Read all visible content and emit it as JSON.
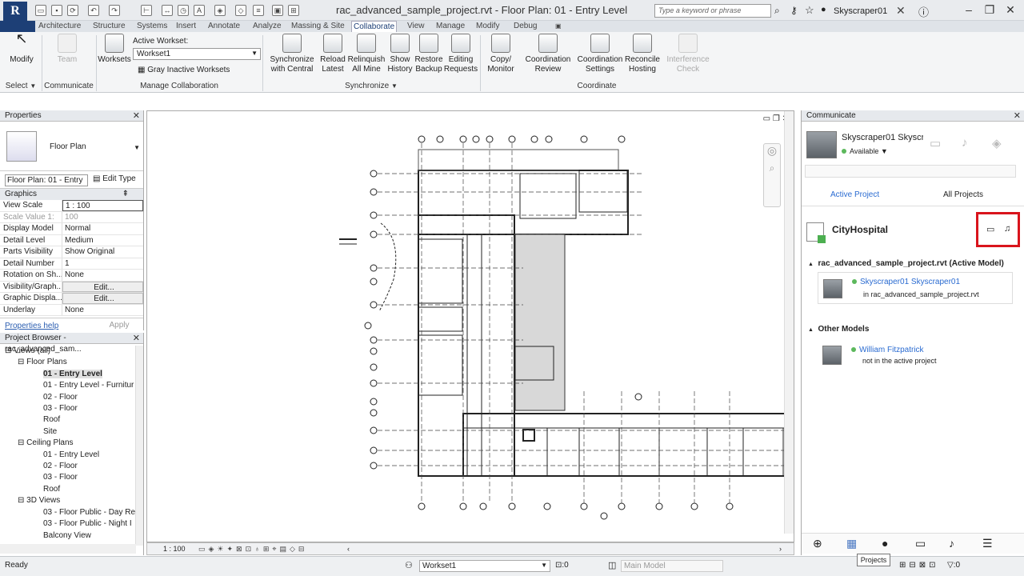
{
  "titlebar": {
    "title": "rac_advanced_sample_project.rvt - Floor Plan: 01 - Entry Level",
    "search_placeholder": "Type a keyword or phrase",
    "username": "Skyscraper01",
    "logo": "R"
  },
  "tabs": [
    "Architecture",
    "Structure",
    "Systems",
    "Insert",
    "Annotate",
    "Analyze",
    "Massing & Site",
    "Collaborate",
    "View",
    "Manage",
    "Modify",
    "Debug"
  ],
  "active_tab": "Collaborate",
  "ribbon": {
    "modify": "Modify",
    "team": "Team",
    "worksets": "Worksets",
    "active_workset_label": "Active Workset:",
    "active_workset_value": "Workset1",
    "gray_inactive": "Gray Inactive Worksets",
    "sync_buttons": [
      {
        "l1": "Synchronize",
        "l2": "with Central"
      },
      {
        "l1": "Reload",
        "l2": "Latest"
      },
      {
        "l1": "Relinquish",
        "l2": "All Mine"
      },
      {
        "l1": "Show",
        "l2": "History"
      },
      {
        "l1": "Restore",
        "l2": "Backup"
      },
      {
        "l1": "Editing",
        "l2": "Requests"
      }
    ],
    "coord_buttons": [
      {
        "l1": "Copy/",
        "l2": "Monitor"
      },
      {
        "l1": "Coordination",
        "l2": "Review"
      },
      {
        "l1": "Coordination",
        "l2": "Settings"
      },
      {
        "l1": "Reconcile",
        "l2": "Hosting"
      },
      {
        "l1": "Interference",
        "l2": "Check"
      }
    ],
    "panels": {
      "select": "Select",
      "communicate": "Communicate",
      "manage_collab": "Manage Collaboration",
      "synchronize": "Synchronize",
      "coordinate": "Coordinate"
    }
  },
  "properties": {
    "title": "Properties",
    "type_name": "Floor Plan",
    "view_selector": "Floor Plan: 01 - Entry",
    "edit_type": "Edit Type",
    "section": "Graphics",
    "rows": [
      {
        "k": "View Scale",
        "v": "1 : 100"
      },
      {
        "k": "Scale Value    1:",
        "v": "100"
      },
      {
        "k": "Display Model",
        "v": "Normal"
      },
      {
        "k": "Detail Level",
        "v": "Medium"
      },
      {
        "k": "Parts Visibility",
        "v": "Show Original"
      },
      {
        "k": "Detail Number",
        "v": "1"
      },
      {
        "k": "Rotation on Sh...",
        "v": "None"
      },
      {
        "k": "Visibility/Graph...",
        "v": "Edit..."
      },
      {
        "k": "Graphic Displa...",
        "v": "Edit..."
      },
      {
        "k": "Underlay",
        "v": "None"
      }
    ],
    "help": "Properties help",
    "apply": "Apply"
  },
  "browser": {
    "title": "Project Browser - rac_advanced_sam...",
    "items": [
      {
        "t": "Views (all)",
        "lvl": 0,
        "ex": "−"
      },
      {
        "t": "Floor Plans",
        "lvl": 1,
        "ex": "−"
      },
      {
        "t": "01 - Entry Level",
        "lvl": 2,
        "sel": true
      },
      {
        "t": "01 - Entry Level - Furnitur",
        "lvl": 2
      },
      {
        "t": "02 - Floor",
        "lvl": 2
      },
      {
        "t": "03 - Floor",
        "lvl": 2
      },
      {
        "t": "Roof",
        "lvl": 2
      },
      {
        "t": "Site",
        "lvl": 2
      },
      {
        "t": "Ceiling Plans",
        "lvl": 1,
        "ex": "−"
      },
      {
        "t": "01 - Entry Level",
        "lvl": 2
      },
      {
        "t": "02 - Floor",
        "lvl": 2
      },
      {
        "t": "03 - Floor",
        "lvl": 2
      },
      {
        "t": "Roof",
        "lvl": 2
      },
      {
        "t": "3D Views",
        "lvl": 1,
        "ex": "−"
      },
      {
        "t": "03 - Floor Public - Day Re",
        "lvl": 2
      },
      {
        "t": "03 - Floor Public - Night I",
        "lvl": 2
      },
      {
        "t": "Balcony View",
        "lvl": 2
      }
    ]
  },
  "view": {
    "scale": "1 : 100"
  },
  "communicate": {
    "title": "Communicate",
    "user_name": "Skyscraper01 Skyscra",
    "status": "Available",
    "tab_active": "Active Project",
    "tab_all": "All Projects",
    "project_name": "CityHospital",
    "active_model": "rac_advanced_sample_project.rvt (Active Model)",
    "member1_name": "Skyscraper01 Skyscraper01",
    "member1_where": "in rac_advanced_sample_project.rvt",
    "other_models": "Other Models",
    "member2_name": "William Fitzpatrick",
    "member2_where": "not in the active project",
    "tooltip": "Projects"
  },
  "statusbar": {
    "ready": "Ready",
    "workset": "Workset1",
    "count": ":0",
    "model": "Main Model",
    "count2": ":0"
  }
}
